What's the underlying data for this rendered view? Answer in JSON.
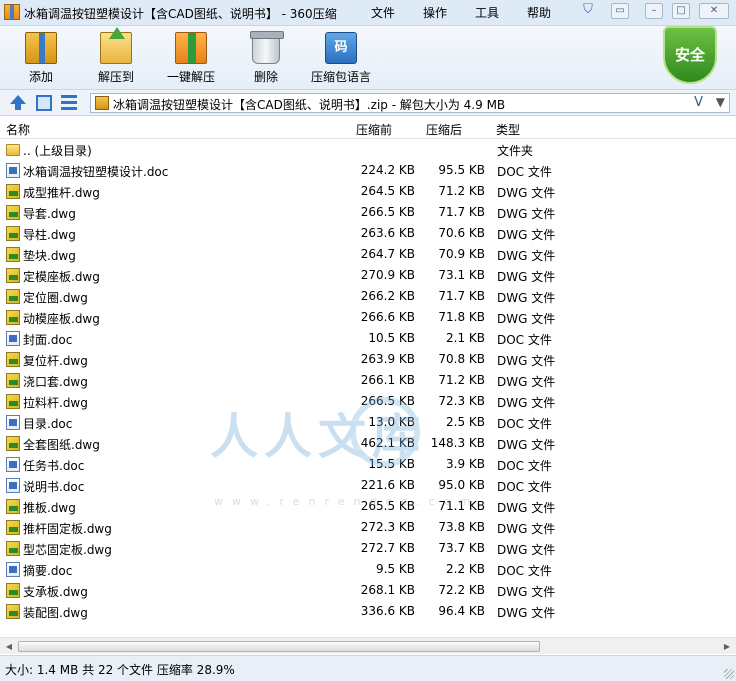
{
  "window": {
    "title": "冰箱调温按钮塑模设计【含CAD图纸、说明书】 - 360压缩",
    "menu": [
      "文件",
      "操作",
      "工具",
      "帮助"
    ],
    "controls": [
      "shirt-icon",
      "comment-icon",
      "minimize-icon",
      "maximize-icon",
      "close-icon"
    ]
  },
  "toolbar": {
    "add": "添加",
    "extract": "解压到",
    "onekey": "一键解压",
    "delete": "删除",
    "language": "压缩包语言",
    "language_glyph": "码",
    "security": "安全"
  },
  "addressbar": {
    "path": "冰箱调温按钮塑模设计【含CAD图纸、说明书】.zip - 解包大小为 4.9 MB",
    "v_label": "V",
    "dropdown": "▼"
  },
  "columns": {
    "name": "名称",
    "size": "压缩前",
    "packed": "压缩后",
    "type": "类型"
  },
  "files": [
    {
      "name": ".. (上级目录)",
      "size": "",
      "packed": "",
      "type": "文件夹",
      "icon": "folder"
    },
    {
      "name": "冰箱调温按钮塑模设计.doc",
      "size": "224.2 KB",
      "packed": "95.5 KB",
      "type": "DOC 文件",
      "icon": "doc"
    },
    {
      "name": "成型推杆.dwg",
      "size": "264.5 KB",
      "packed": "71.2 KB",
      "type": "DWG 文件",
      "icon": "dwg"
    },
    {
      "name": "导套.dwg",
      "size": "266.5 KB",
      "packed": "71.7 KB",
      "type": "DWG 文件",
      "icon": "dwg"
    },
    {
      "name": "导柱.dwg",
      "size": "263.6 KB",
      "packed": "70.6 KB",
      "type": "DWG 文件",
      "icon": "dwg"
    },
    {
      "name": "垫块.dwg",
      "size": "264.7 KB",
      "packed": "70.9 KB",
      "type": "DWG 文件",
      "icon": "dwg"
    },
    {
      "name": "定模座板.dwg",
      "size": "270.9 KB",
      "packed": "73.1 KB",
      "type": "DWG 文件",
      "icon": "dwg"
    },
    {
      "name": "定位圈.dwg",
      "size": "266.2 KB",
      "packed": "71.7 KB",
      "type": "DWG 文件",
      "icon": "dwg"
    },
    {
      "name": "动模座板.dwg",
      "size": "266.6 KB",
      "packed": "71.8 KB",
      "type": "DWG 文件",
      "icon": "dwg"
    },
    {
      "name": "封面.doc",
      "size": "10.5 KB",
      "packed": "2.1 KB",
      "type": "DOC 文件",
      "icon": "doc"
    },
    {
      "name": "复位杆.dwg",
      "size": "263.9 KB",
      "packed": "70.8 KB",
      "type": "DWG 文件",
      "icon": "dwg"
    },
    {
      "name": "浇口套.dwg",
      "size": "266.1 KB",
      "packed": "71.2 KB",
      "type": "DWG 文件",
      "icon": "dwg"
    },
    {
      "name": "拉料杆.dwg",
      "size": "266.5 KB",
      "packed": "72.3 KB",
      "type": "DWG 文件",
      "icon": "dwg"
    },
    {
      "name": "目录.doc",
      "size": "13.0 KB",
      "packed": "2.5 KB",
      "type": "DOC 文件",
      "icon": "doc"
    },
    {
      "name": "全套图纸.dwg",
      "size": "462.1 KB",
      "packed": "148.3 KB",
      "type": "DWG 文件",
      "icon": "dwg"
    },
    {
      "name": "任务书.doc",
      "size": "15.5 KB",
      "packed": "3.9 KB",
      "type": "DOC 文件",
      "icon": "doc"
    },
    {
      "name": "说明书.doc",
      "size": "221.6 KB",
      "packed": "95.0 KB",
      "type": "DOC 文件",
      "icon": "doc"
    },
    {
      "name": "推板.dwg",
      "size": "265.5 KB",
      "packed": "71.1 KB",
      "type": "DWG 文件",
      "icon": "dwg"
    },
    {
      "name": "推杆固定板.dwg",
      "size": "272.3 KB",
      "packed": "73.8 KB",
      "type": "DWG 文件",
      "icon": "dwg"
    },
    {
      "name": "型芯固定板.dwg",
      "size": "272.7 KB",
      "packed": "73.7 KB",
      "type": "DWG 文件",
      "icon": "dwg"
    },
    {
      "name": "摘要.doc",
      "size": "9.5 KB",
      "packed": "2.2 KB",
      "type": "DOC 文件",
      "icon": "doc"
    },
    {
      "name": "支承板.dwg",
      "size": "268.1 KB",
      "packed": "72.2 KB",
      "type": "DWG 文件",
      "icon": "dwg"
    },
    {
      "name": "装配图.dwg",
      "size": "336.6 KB",
      "packed": "96.4 KB",
      "type": "DWG 文件",
      "icon": "dwg"
    }
  ],
  "watermark": {
    "text": "人人文库",
    "url": "www.renrendoc.com"
  },
  "status": "大小: 1.4 MB 共 22 个文件 压缩率 28.9%"
}
